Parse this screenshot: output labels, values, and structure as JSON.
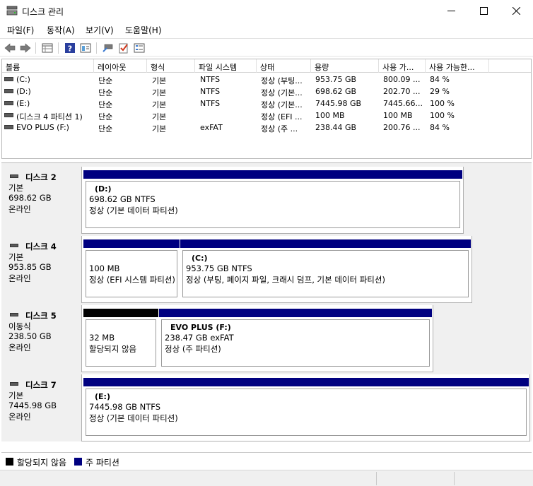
{
  "window": {
    "title": "디스크 관리"
  },
  "menu": [
    "파일(F)",
    "동작(A)",
    "보기(V)",
    "도움말(H)"
  ],
  "toolbar": {
    "icons": [
      "back-icon",
      "forward-icon",
      "properties-grid-icon",
      "help-icon",
      "view-panel-icon",
      "connect-icon",
      "check-icon",
      "list-icon"
    ]
  },
  "volume_list": {
    "columns": [
      "볼륨",
      "레이아웃",
      "형식",
      "파일 시스템",
      "상태",
      "용량",
      "사용 가...",
      "사용 가능한..."
    ],
    "rows": [
      [
        "(C:)",
        "단순",
        "기본",
        "NTFS",
        "정상 (부팅...",
        "953.75 GB",
        "800.09 ...",
        "84 %"
      ],
      [
        "(D:)",
        "단순",
        "기본",
        "NTFS",
        "정상 (기본...",
        "698.62 GB",
        "202.70 ...",
        "29 %"
      ],
      [
        "(E:)",
        "단순",
        "기본",
        "NTFS",
        "정상 (기본...",
        "7445.98 GB",
        "7445.66...",
        "100 %"
      ],
      [
        "(디스크 4 파티션 1)",
        "단순",
        "기본",
        "",
        "정상 (EFI ...",
        "100 MB",
        "100 MB",
        "100 %"
      ],
      [
        "EVO PLUS (F:)",
        "단순",
        "기본",
        "exFAT",
        "정상 (주 ...",
        "238.44 GB",
        "200.76 ...",
        "84 %"
      ]
    ]
  },
  "disks": [
    {
      "name": "디스크 2",
      "type": "기본",
      "size": "698.62 GB",
      "status": "온라인",
      "partitions": [
        {
          "name": "(D:)",
          "size": "698.62 GB NTFS",
          "status": "정상 (기본 데이터 파티션)"
        }
      ]
    },
    {
      "name": "디스크 4",
      "type": "기본",
      "size": "953.85 GB",
      "status": "온라인",
      "partitions": [
        {
          "name": "",
          "size": "100 MB",
          "status": "정상 (EFI 시스템 파티션)"
        },
        {
          "name": "(C:)",
          "size": "953.75 GB NTFS",
          "status": "정상 (부팅, 페이지 파일, 크래시 덤프, 기본 데이터 파티션)"
        }
      ]
    },
    {
      "name": "디스크 5",
      "type": "이동식",
      "size": "238.50 GB",
      "status": "온라인",
      "partitions": [
        {
          "name": "",
          "size": "32 MB",
          "status": "할당되지 않음"
        },
        {
          "name": "EVO PLUS  (F:)",
          "size": "238.47 GB exFAT",
          "status": "정상 (주 파티션)"
        }
      ]
    },
    {
      "name": "디스크 7",
      "type": "기본",
      "size": "7445.98 GB",
      "status": "온라인",
      "partitions": [
        {
          "name": "(E:)",
          "size": "7445.98 GB NTFS",
          "status": "정상 (기본 데이터 파티션)"
        }
      ]
    }
  ],
  "legend": {
    "unallocated": "할당되지 않음",
    "primary": "주 파티션",
    "colors": {
      "unallocated": "#000000",
      "primary": "#000080"
    }
  }
}
